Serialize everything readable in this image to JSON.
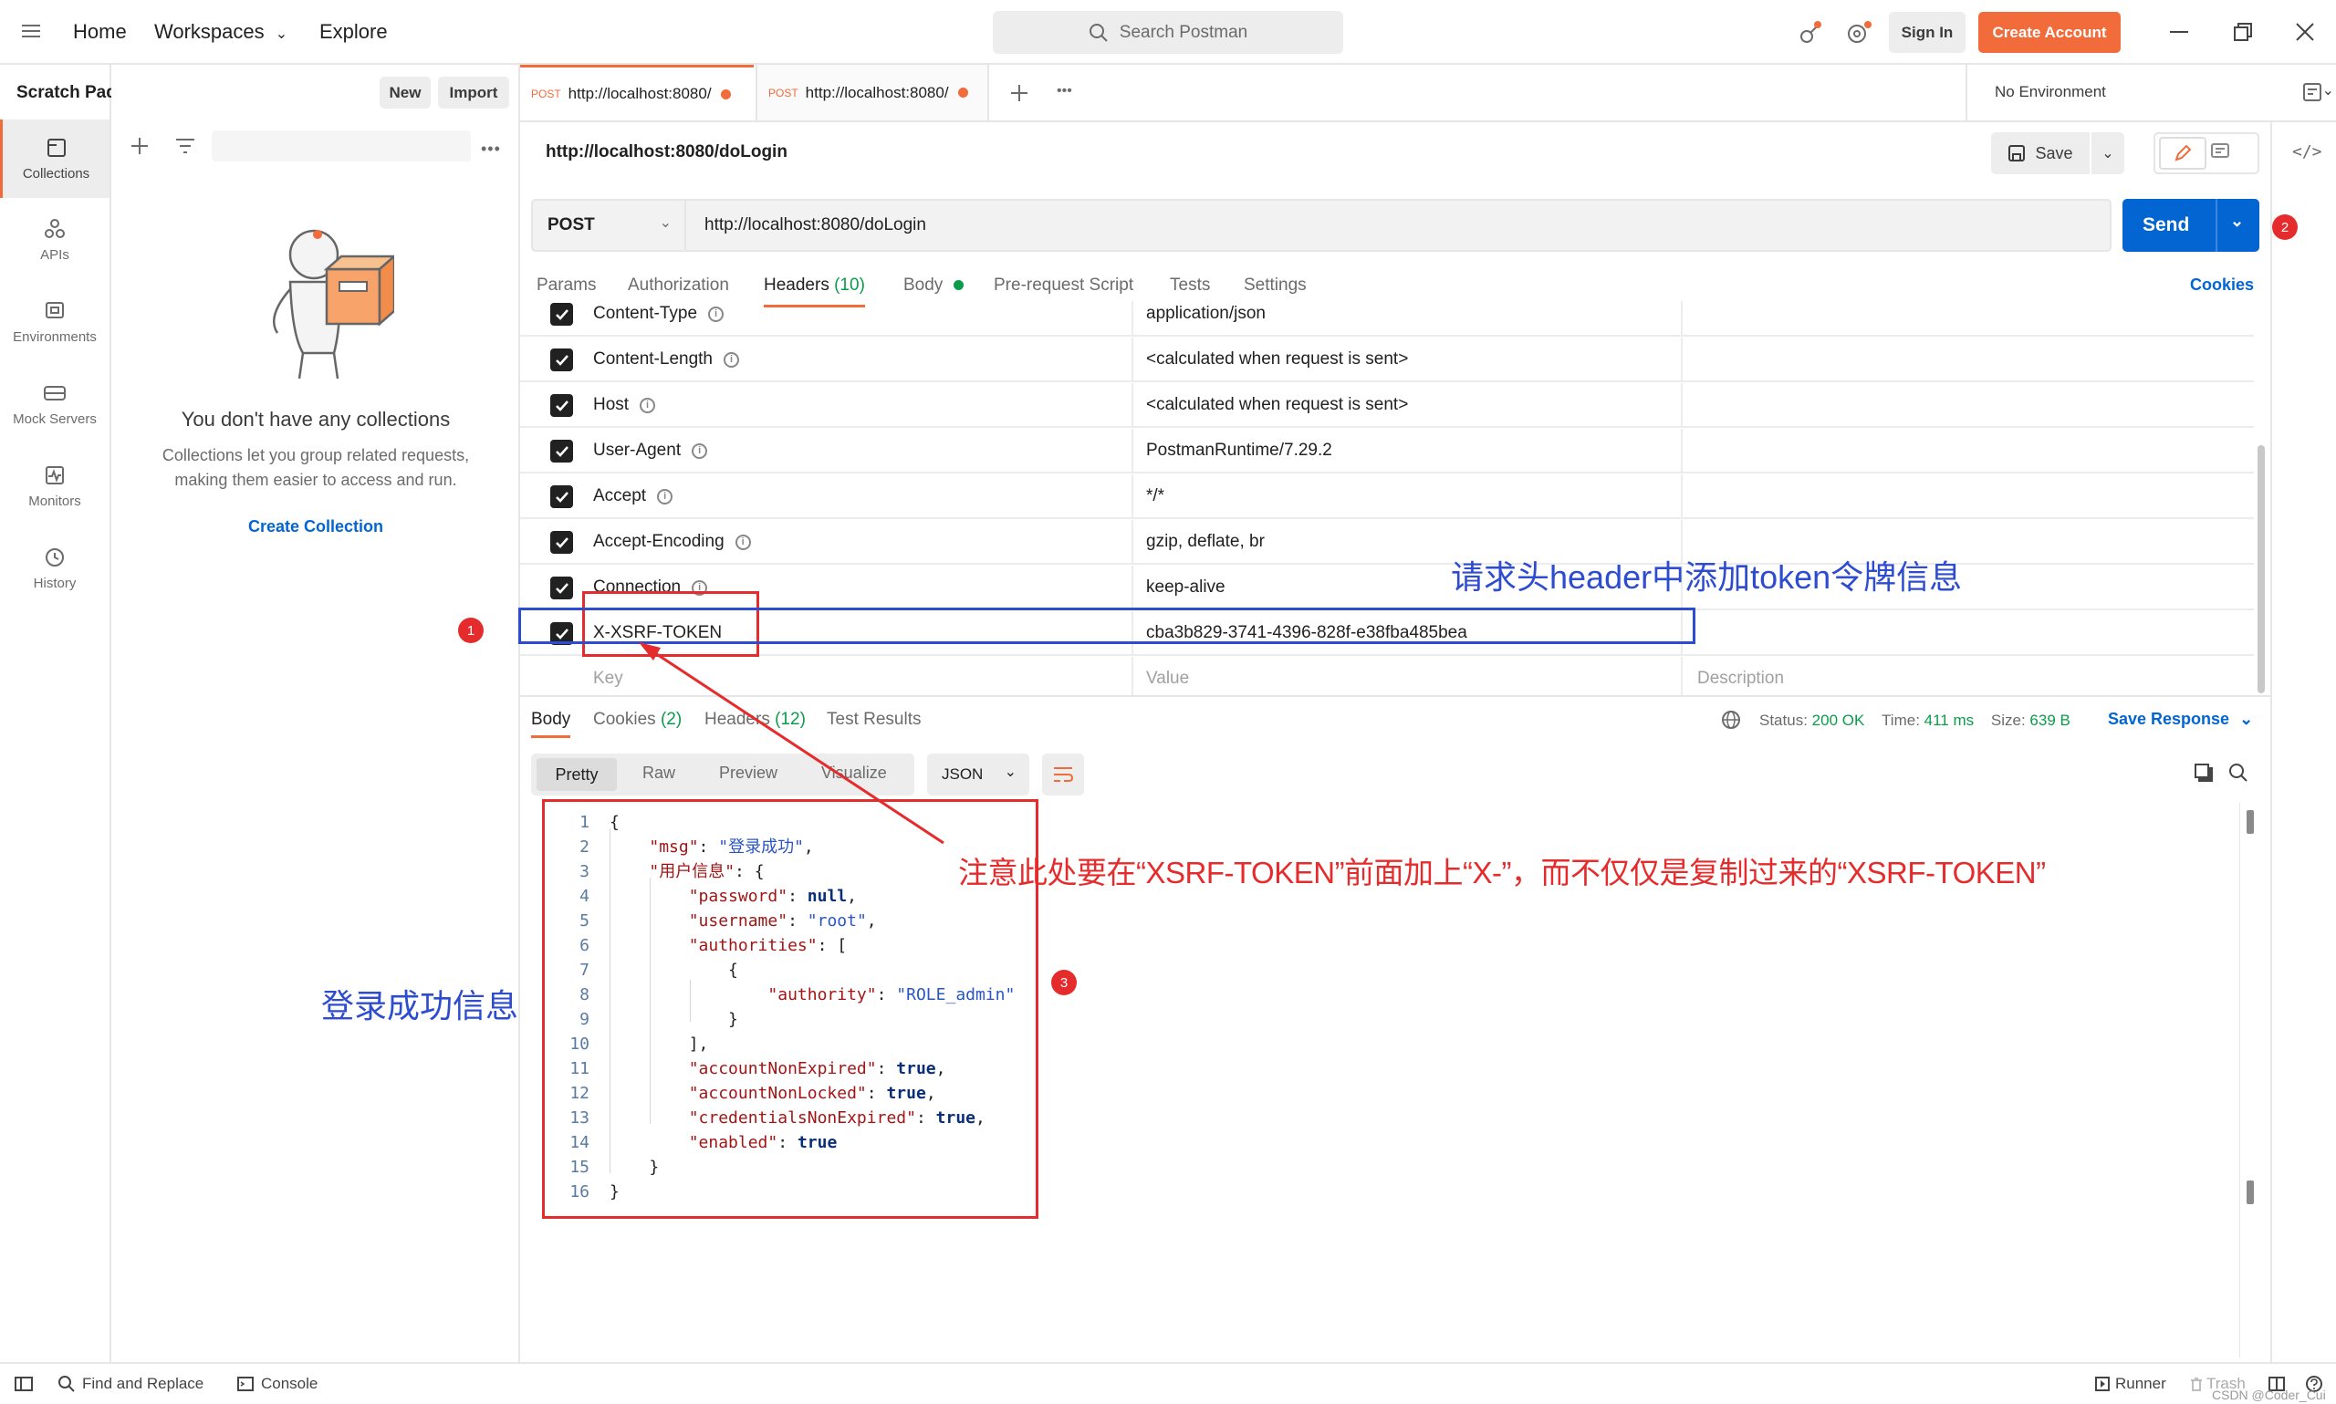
{
  "topbar": {
    "home": "Home",
    "workspaces": "Workspaces",
    "explore": "Explore",
    "search_placeholder": "Search Postman",
    "sign_in": "Sign In",
    "create_account": "Create Account"
  },
  "sidebar": {
    "title": "Scratch Pad",
    "new_label": "New",
    "import_label": "Import",
    "items": [
      {
        "label": "Collections",
        "icon": "collections-icon"
      },
      {
        "label": "APIs",
        "icon": "apis-icon"
      },
      {
        "label": "Environments",
        "icon": "environments-icon"
      },
      {
        "label": "Mock Servers",
        "icon": "mock-servers-icon"
      },
      {
        "label": "Monitors",
        "icon": "monitors-icon"
      },
      {
        "label": "History",
        "icon": "history-icon"
      }
    ],
    "empty_title": "You don't have any collections",
    "empty_text_1": "Collections let you group related requests,",
    "empty_text_2": "making them easier to access and run.",
    "create_collection": "Create Collection"
  },
  "tabs": [
    {
      "method": "POST",
      "url": "http://localhost:8080/"
    },
    {
      "method": "POST",
      "url": "http://localhost:8080/"
    }
  ],
  "environment": "No Environment",
  "request": {
    "title": "http://localhost:8080/doLogin",
    "save_label": "Save",
    "method": "POST",
    "url": "http://localhost:8080/doLogin",
    "send_label": "Send",
    "cookies_label": "Cookies",
    "subtabs": [
      "Params",
      "Authorization",
      "Headers",
      "Body",
      "Pre-request Script",
      "Tests",
      "Settings"
    ],
    "headers_count": "(10)"
  },
  "headers": [
    {
      "key": "Content-Type",
      "value": "application/json"
    },
    {
      "key": "Content-Length",
      "value": "<calculated when request is sent>"
    },
    {
      "key": "Host",
      "value": "<calculated when request is sent>"
    },
    {
      "key": "User-Agent",
      "value": "PostmanRuntime/7.29.2"
    },
    {
      "key": "Accept",
      "value": "*/*"
    },
    {
      "key": "Accept-Encoding",
      "value": "gzip, deflate, br"
    },
    {
      "key": "Connection",
      "value": "keep-alive"
    },
    {
      "key": "X-XSRF-TOKEN",
      "value": "cba3b829-3741-4396-828f-e38fba485bea"
    }
  ],
  "header_placeholders": {
    "key": "Key",
    "value": "Value",
    "description": "Description"
  },
  "response": {
    "tabs": {
      "body": "Body",
      "cookies": "Cookies",
      "cookies_count": "(2)",
      "headers": "Headers",
      "headers_count": "(12)",
      "test_results": "Test Results"
    },
    "status_label": "Status:",
    "status_value": "200 OK",
    "time_label": "Time:",
    "time_value": "411 ms",
    "size_label": "Size:",
    "size_value": "639 B",
    "save_response": "Save Response",
    "views": [
      "Pretty",
      "Raw",
      "Preview",
      "Visualize"
    ],
    "format": "JSON"
  },
  "code_lines": [
    {
      "n": "1",
      "t": "{"
    },
    {
      "n": "2",
      "t": "    \"msg\": \"登录成功\","
    },
    {
      "n": "3",
      "t": "    \"用户信息\": {"
    },
    {
      "n": "4",
      "t": "        \"password\": null,"
    },
    {
      "n": "5",
      "t": "        \"username\": \"root\","
    },
    {
      "n": "6",
      "t": "        \"authorities\": ["
    },
    {
      "n": "7",
      "t": "            {"
    },
    {
      "n": "8",
      "t": "                \"authority\": \"ROLE_admin\""
    },
    {
      "n": "9",
      "t": "            }"
    },
    {
      "n": "10",
      "t": "        ],"
    },
    {
      "n": "11",
      "t": "        \"accountNonExpired\": true,"
    },
    {
      "n": "12",
      "t": "        \"accountNonLocked\": true,"
    },
    {
      "n": "13",
      "t": "        \"credentialsNonExpired\": true,"
    },
    {
      "n": "14",
      "t": "        \"enabled\": true"
    },
    {
      "n": "15",
      "t": "    }"
    },
    {
      "n": "16",
      "t": "}"
    }
  ],
  "annotations": {
    "badge1": "1",
    "badge2": "2",
    "badge3": "3",
    "header_note": "请求头header中添加token令牌信息",
    "token_note": "注意此处要在“XSRF-TOKEN”前面加上“X-”，而不仅仅是复制过来的“XSRF-TOKEN”",
    "login_note": "登录成功信息"
  },
  "footer": {
    "find_replace": "Find and Replace",
    "console": "Console",
    "runner": "Runner",
    "trash": "Trash",
    "watermark": "CSDN @Coder_Cui"
  },
  "colors": {
    "accent": "#f26b3a",
    "send": "#0265d2",
    "annotation_red": "#e52b2b",
    "annotation_blue": "#2d4ccf"
  }
}
